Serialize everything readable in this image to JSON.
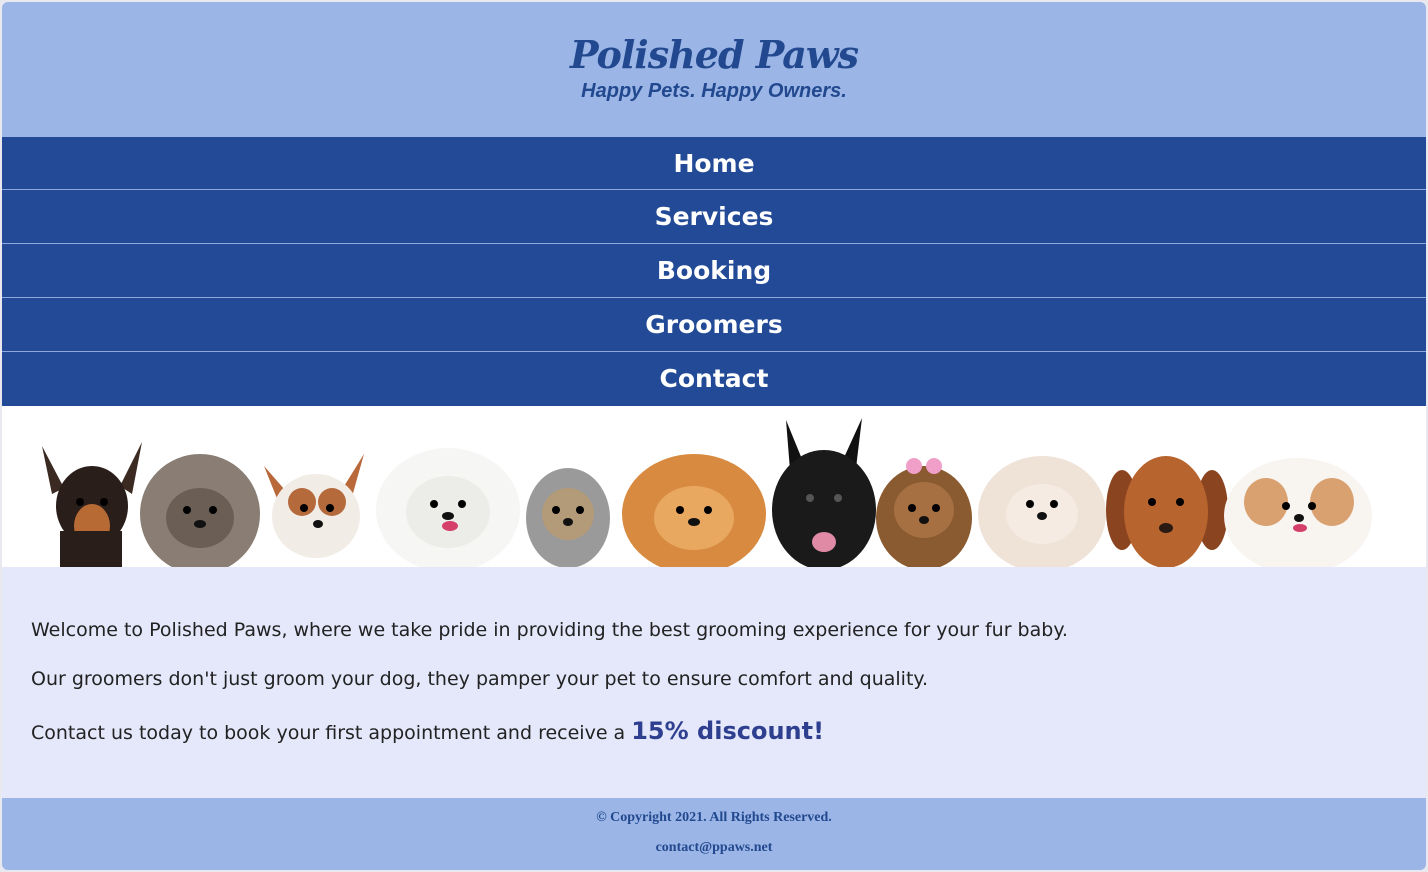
{
  "header": {
    "brand": "Polished Paws",
    "tagline": "Happy Pets. Happy Owners."
  },
  "nav": {
    "items": [
      "Home",
      "Services",
      "Booking",
      "Groomers",
      "Contact"
    ]
  },
  "banner": {
    "image": "row-of-small-dogs-photo"
  },
  "main": {
    "p1": "Welcome to Polished Paws, where we take pride in providing the best grooming experience for your fur baby.",
    "p2": "Our groomers don't just groom your dog, they pamper your pet to ensure comfort and quality.",
    "p3": "Contact us today to book your first appointment and receive a ",
    "discount": "15% discount!"
  },
  "footer": {
    "copyright": "© Copyright 2021. All Rights Reserved.",
    "email": "contact@ppaws.net"
  },
  "colors": {
    "header_bg": "#9bb5e6",
    "nav_bg": "#224a96",
    "brand": "#22498f",
    "main_bg": "#e4e8fa",
    "discount": "#2f3f8f"
  }
}
